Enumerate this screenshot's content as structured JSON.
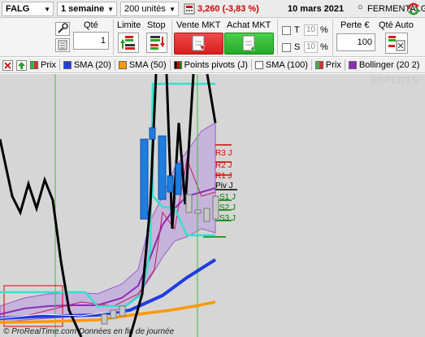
{
  "toolbar": {
    "ticker": "FALG",
    "period": "1 semaine",
    "units": "200 unités",
    "price_change": "3,260 (-3,83 %)",
    "date": "10 mars 2021",
    "company": "FERMENTALG"
  },
  "order_panel": {
    "qty_label": "Qté",
    "qty_value": "1",
    "limit_label": "Limite",
    "stop_label": "Stop",
    "sell_label": "Vente MKT",
    "buy_label": "Achat MKT",
    "t_label": "T",
    "s_label": "S",
    "t_pct": "10",
    "s_pct": "10",
    "pct_sign": "%",
    "loss_label": "Perte €",
    "loss_value": "100",
    "auto_qty_label": "Qté Auto"
  },
  "legend": {
    "items": [
      {
        "label": "Prix",
        "color": "#3cb44b"
      },
      {
        "label": "SMA (20)",
        "color": "#1f3de0"
      },
      {
        "label": "SMA (50)",
        "color": "#ff9900"
      },
      {
        "label": "Points pivots (J)",
        "color": "#000000"
      },
      {
        "label": "SMA (100)",
        "color": "#ffffff"
      },
      {
        "label": "Prix",
        "color": "#3cb44b"
      },
      {
        "label": "Bollinger (20 2)",
        "color": "#8e2bb8"
      }
    ]
  },
  "chart": {
    "watermark": "EXPERTS",
    "footer": "© ProRealTime.com Données en fin de journée",
    "pivot_labels": [
      {
        "label": "R3 J",
        "color": "#e00000"
      },
      {
        "label": "R2 J",
        "color": "#e00000"
      },
      {
        "label": "R1 J",
        "color": "#e00000"
      },
      {
        "label": "Piv J",
        "color": "#000000"
      },
      {
        "label": "S1 J",
        "color": "#008000"
      },
      {
        "label": "S2 J",
        "color": "#008000"
      },
      {
        "label": "S3 J",
        "color": "#008000"
      }
    ]
  }
}
